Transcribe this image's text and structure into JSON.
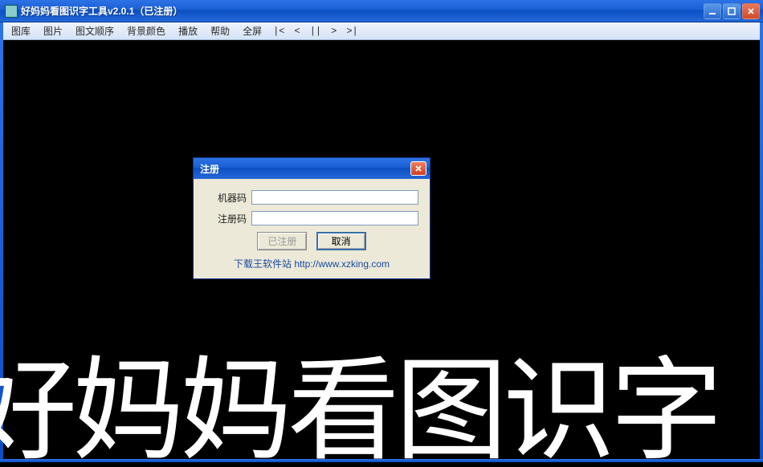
{
  "window": {
    "title": "好妈妈看图识字工具v2.0.1（已注册）"
  },
  "menu": {
    "items": [
      "图库",
      "图片",
      "图文顺序",
      "背景颜色",
      "播放",
      "帮助",
      "全屏"
    ],
    "controls": {
      "first": "|<",
      "prev": "<",
      "pause": "||",
      "next": ">",
      "last": ">|"
    }
  },
  "content": {
    "banner_text": "好妈妈看图识字"
  },
  "dialog": {
    "title": "注册",
    "fields": {
      "machine_label": "机器码",
      "machine_value": "",
      "regcode_label": "注册码",
      "regcode_value": ""
    },
    "buttons": {
      "registered": "已注册",
      "cancel": "取消"
    },
    "link_text": "下载王软件站 ",
    "link_url": "http://www.xzking.com"
  }
}
